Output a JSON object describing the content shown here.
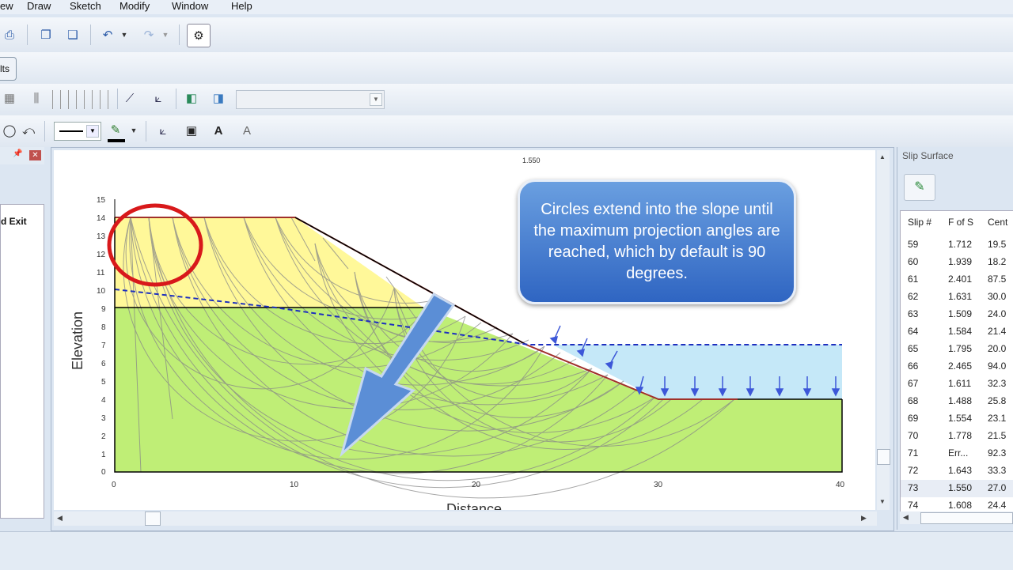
{
  "menu": [
    "ew",
    "Draw",
    "Sketch",
    "Modify",
    "Window",
    "Help"
  ],
  "results_button": "lts",
  "left_panel": {
    "label": "d Exit"
  },
  "plot": {
    "fos_label": "1.550",
    "x_label": "Distance",
    "y_label": "Elevation",
    "x_ticks": [
      "0",
      "10",
      "20",
      "30",
      "40"
    ],
    "y_ticks": [
      "0",
      "1",
      "2",
      "3",
      "4",
      "5",
      "6",
      "7",
      "8",
      "9",
      "10",
      "11",
      "12",
      "13",
      "14",
      "15"
    ]
  },
  "callout": {
    "text": "Circles extend into the slope until the maximum projection angles are reached, which by default is 90 degrees."
  },
  "right_panel": {
    "title": "Slip Surface",
    "columns": [
      "Slip #",
      "F of S",
      "Cent"
    ],
    "rows": [
      [
        "59",
        "1.712",
        "19.5"
      ],
      [
        "60",
        "1.939",
        "18.2"
      ],
      [
        "61",
        "2.401",
        "87.5"
      ],
      [
        "62",
        "1.631",
        "30.0"
      ],
      [
        "63",
        "1.509",
        "24.0"
      ],
      [
        "64",
        "1.584",
        "21.4"
      ],
      [
        "65",
        "1.795",
        "20.0"
      ],
      [
        "66",
        "2.465",
        "94.0"
      ],
      [
        "67",
        "1.611",
        "32.3"
      ],
      [
        "68",
        "1.488",
        "25.8"
      ],
      [
        "69",
        "1.554",
        "23.1"
      ],
      [
        "70",
        "1.778",
        "21.5"
      ],
      [
        "71",
        "Err...",
        "92.3"
      ],
      [
        "72",
        "1.643",
        "33.3"
      ],
      [
        "73",
        "1.550",
        "27.0"
      ],
      [
        "74",
        "1.608",
        "24.4"
      ]
    ],
    "selected_slip": "73"
  }
}
